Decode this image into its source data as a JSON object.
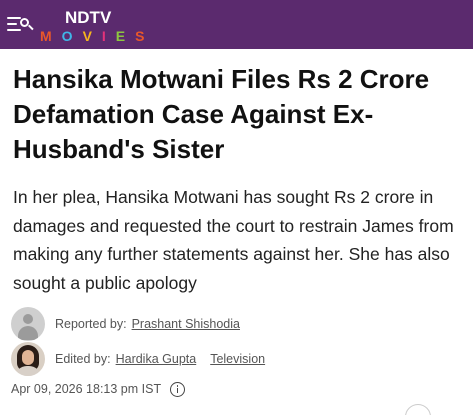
{
  "header": {
    "logo_top": "NDTV",
    "logo_bottom_letters": [
      "M",
      "O",
      "V",
      "I",
      "E",
      "S"
    ],
    "logo_bottom_colors": [
      "#e8572a",
      "#3fb6e8",
      "#f6b51e",
      "#e4327a",
      "#8dc63f",
      "#e8572a"
    ],
    "background_color": "#5b2a6e",
    "menu_icon": "menu-search-icon"
  },
  "article": {
    "headline": "Hansika Motwani Files Rs 2 Crore Defamation Case Against Ex-Husband's Sister",
    "summary": "In her plea, Hansika Motwani has sought Rs 2 crore in damages and requested the court to restrain James from making any further statements against her. She has also sought a public apology"
  },
  "byline": {
    "reported_label": "Reported by:",
    "reporter": "Prashant Shishodia",
    "edited_label": "Edited by:",
    "editor": "Hardika Gupta",
    "category": "Television",
    "date": "Apr 09, 2026 18:13 pm IST",
    "info_icon": "info-icon"
  }
}
